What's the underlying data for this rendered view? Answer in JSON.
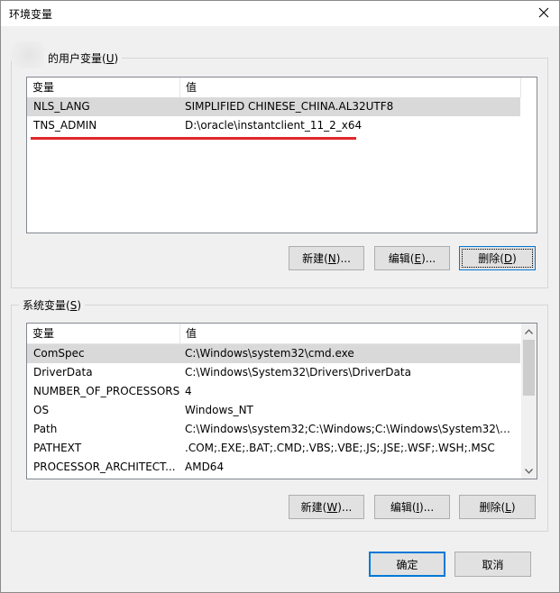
{
  "window": {
    "title": "环境变量"
  },
  "user_vars": {
    "group_label_pre": "的用户变量(",
    "group_label_key": "U",
    "group_label_post": ")",
    "columns": {
      "name": "变量",
      "value": "值"
    },
    "rows": [
      {
        "name": "NLS_LANG",
        "value": "SIMPLIFIED CHINESE_CHINA.AL32UTF8"
      },
      {
        "name": "TNS_ADMIN",
        "value": "D:\\oracle\\instantclient_11_2_x64"
      }
    ],
    "buttons": {
      "new_pre": "新建(",
      "new_key": "N",
      "new_post": ")...",
      "edit_pre": "编辑(",
      "edit_key": "E",
      "edit_post": ")...",
      "delete_pre": "删除(",
      "delete_key": "D",
      "delete_post": ")"
    },
    "highlight_color": "#e0262b"
  },
  "system_vars": {
    "group_label_pre": "系统变量(",
    "group_label_key": "S",
    "group_label_post": ")",
    "columns": {
      "name": "变量",
      "value": "值"
    },
    "rows": [
      {
        "name": "ComSpec",
        "value": "C:\\Windows\\system32\\cmd.exe"
      },
      {
        "name": "DriverData",
        "value": "C:\\Windows\\System32\\Drivers\\DriverData"
      },
      {
        "name": "NUMBER_OF_PROCESSORS",
        "value": "4"
      },
      {
        "name": "OS",
        "value": "Windows_NT"
      },
      {
        "name": "Path",
        "value": "C:\\Windows\\system32;C:\\Windows;C:\\Windows\\System32\\Wb..."
      },
      {
        "name": "PATHEXT",
        "value": ".COM;.EXE;.BAT;.CMD;.VBS;.VBE;.JS;.JSE;.WSF;.WSH;.MSC"
      },
      {
        "name": "PROCESSOR_ARCHITECT...",
        "value": "AMD64"
      }
    ],
    "buttons": {
      "new_pre": "新建(",
      "new_key": "W",
      "new_post": ")...",
      "edit_pre": "编辑(",
      "edit_key": "I",
      "edit_post": ")...",
      "delete_pre": "删除(",
      "delete_key": "L",
      "delete_post": ")"
    }
  },
  "footer": {
    "ok": "确定",
    "cancel": "取消"
  },
  "icons": {
    "close": "close-icon",
    "scroll_up": "chevron-up-icon",
    "scroll_down": "chevron-down-icon"
  }
}
